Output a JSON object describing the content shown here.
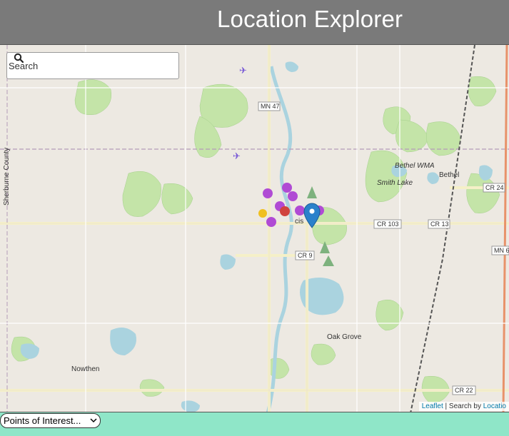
{
  "header": {
    "title": "Location Explorer"
  },
  "search": {
    "placeholder": "Search",
    "icon": "search-icon"
  },
  "map": {
    "route_labels": [
      "MN 47",
      "CR 24",
      "CR 103",
      "CR 13",
      "CR 9",
      "MN 6",
      "CR 22"
    ],
    "place_labels": [
      "Bethel",
      "Bethel WMA",
      "Smith Lake",
      "Oak Grove",
      "Nowthen",
      "Sherburne County",
      "cis"
    ],
    "attribution": {
      "leaflet": "Leaflet",
      "separator": " | Search by ",
      "provider": "Locatio"
    }
  },
  "poi": {
    "selected": "Points of Interest..."
  },
  "colors": {
    "header": "#7a7a7a",
    "footer": "#8fe6c8",
    "water": "#aad3df",
    "marker_pin": "#2a81cb",
    "poi_purple": "#b04bd4",
    "park": "#c8e8b0"
  }
}
